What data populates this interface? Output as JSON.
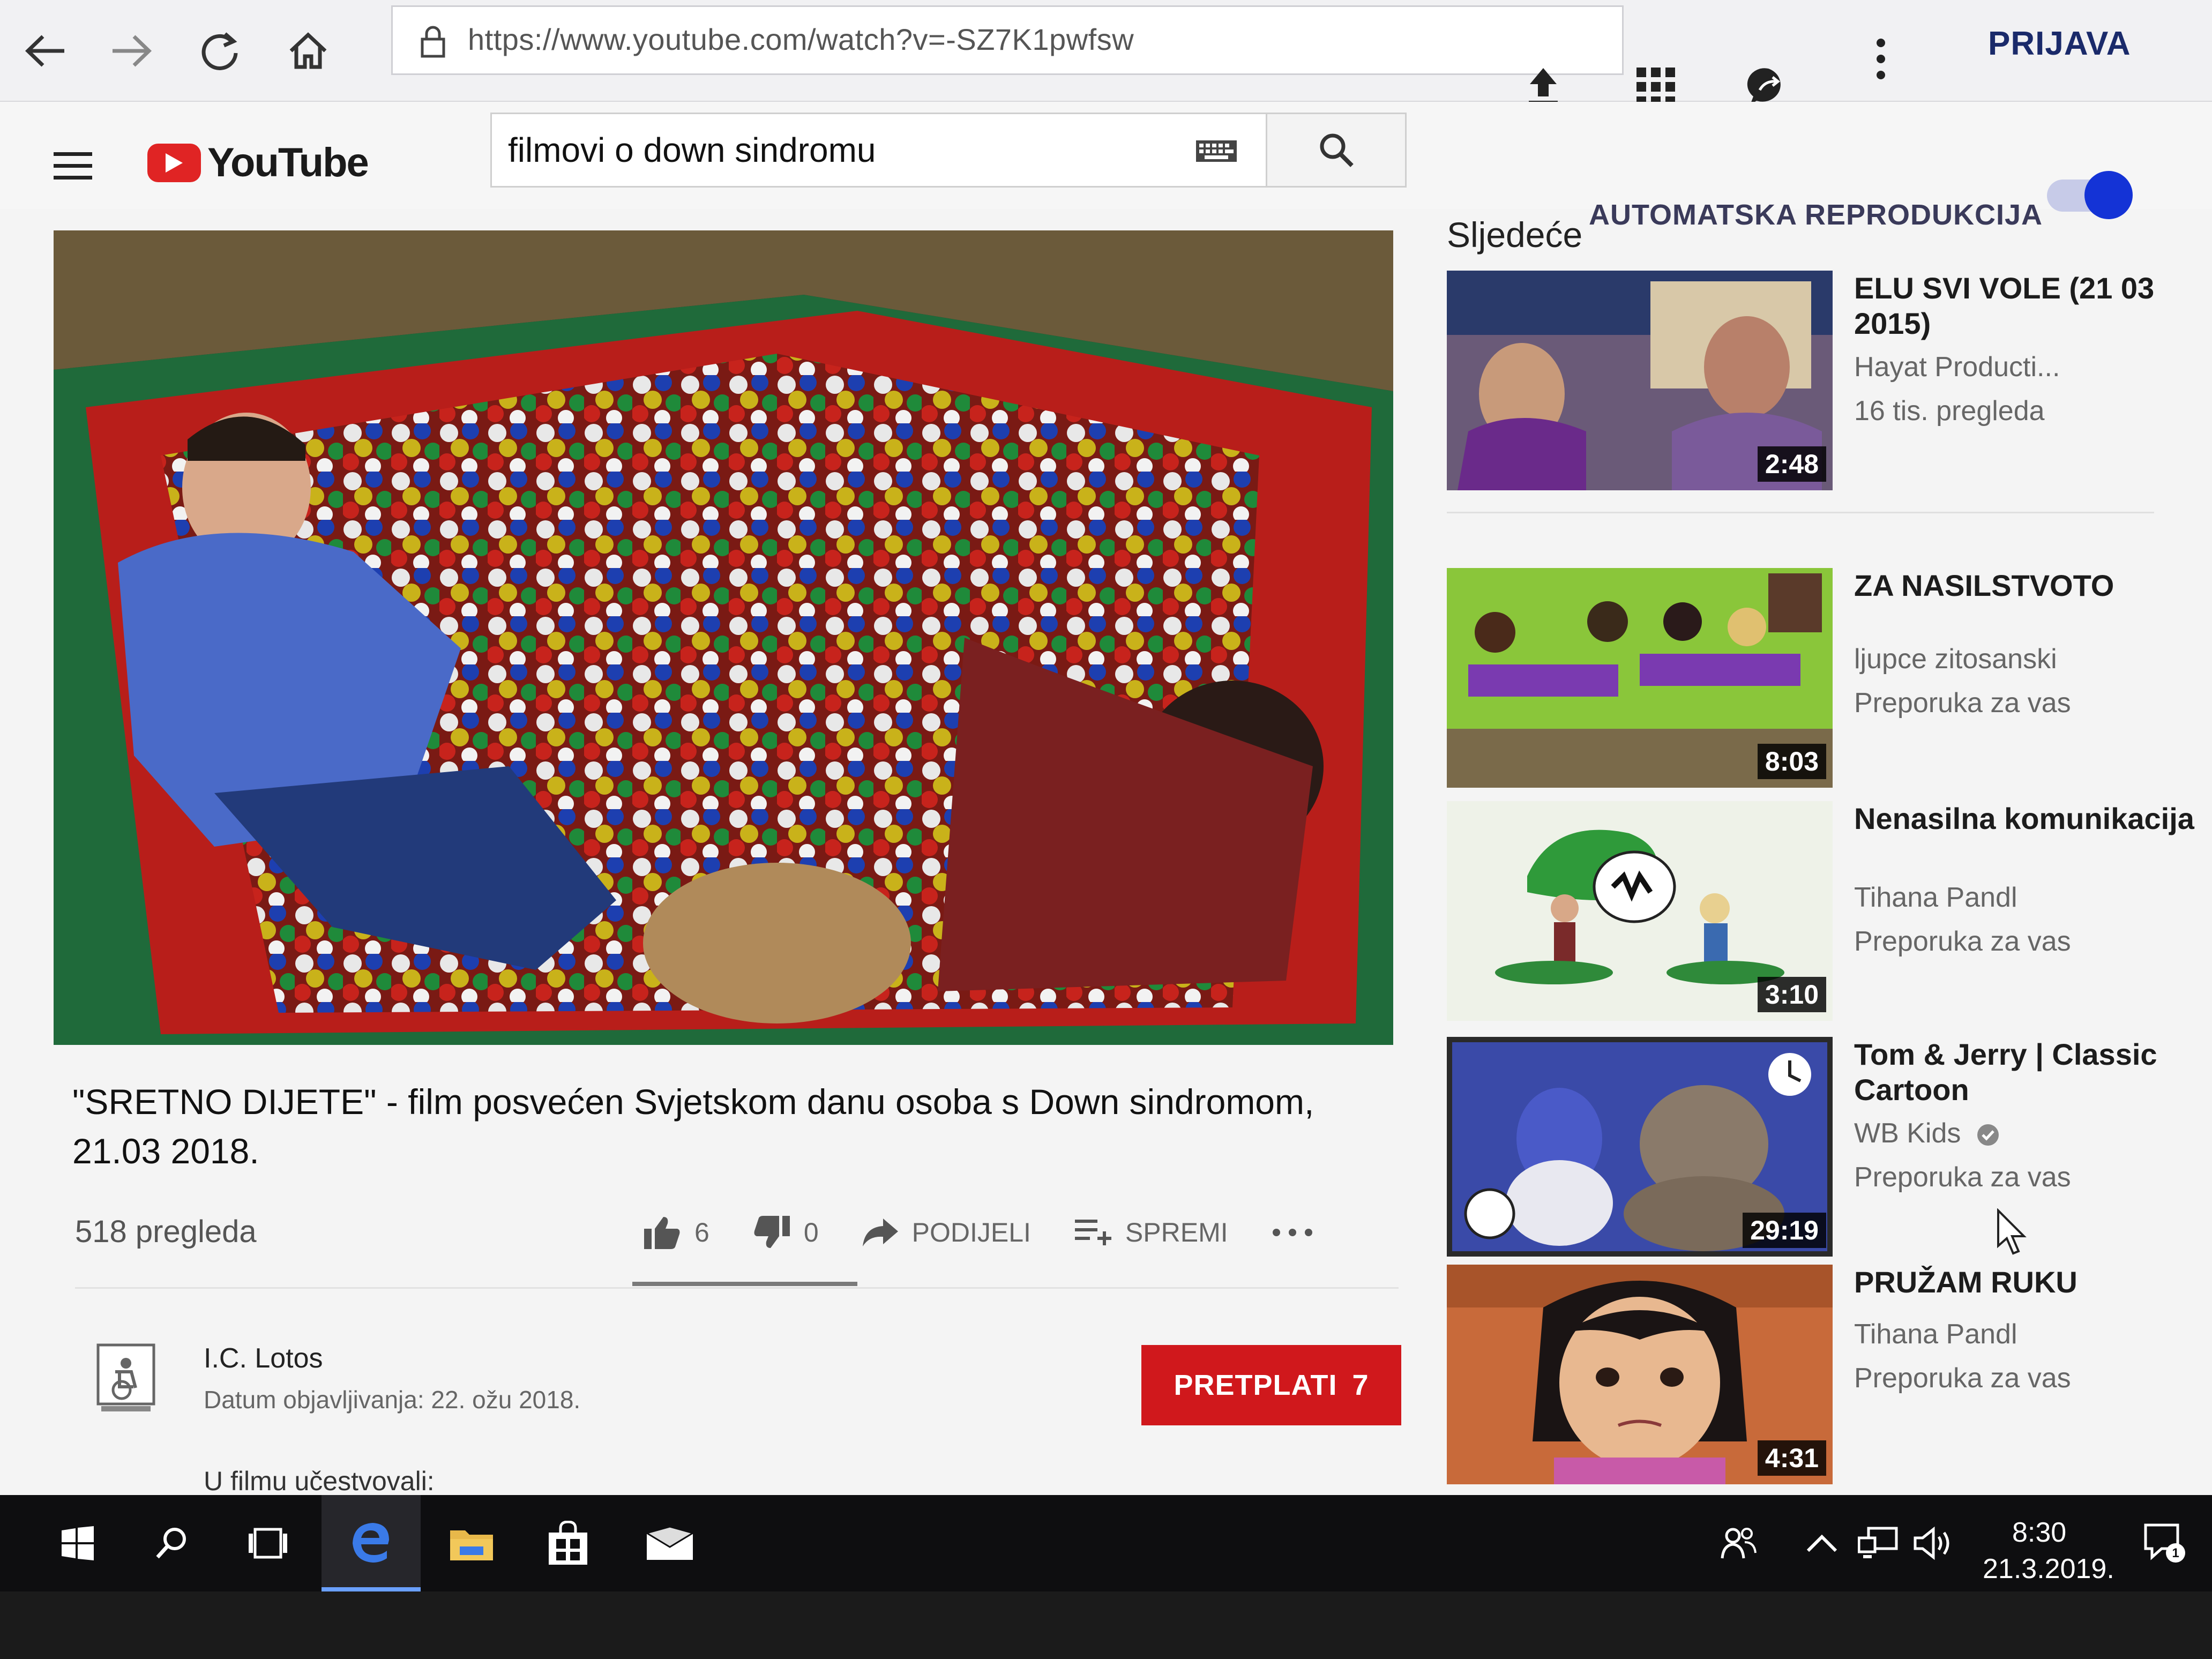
{
  "browser": {
    "url": "https://www.youtube.com/watch?v=-SZ7K1pwfsw",
    "signin_label": "PRIJAVA"
  },
  "youtube": {
    "logo_text": "YouTube",
    "search_value": "filmovi o down sindromu"
  },
  "video": {
    "title": "\"SRETNO DIJETE\" - film posvećen Svjetskom danu osoba s Down sindromom, 21.03 2018.",
    "views": "518 pregleda",
    "likes": "6",
    "dislikes": "0",
    "share_label": "PODIJELI",
    "save_label": "SPREMI",
    "channel": "I.C. Lotos",
    "published": "Datum objavljivanja: 22. ožu 2018.",
    "subscribe_label": "PRETPLATI",
    "subscriber_count": "7",
    "description_start": "U filmu učestvovali:"
  },
  "sidebar": {
    "up_next_label": "Sljedeće",
    "autoplay_label": "AUTOMATSKA REPRODUKCIJA",
    "autoplay_on": true,
    "items": [
      {
        "title": "ELU SVI VOLE (21 03 2015)",
        "channel": "Hayat Producti...",
        "meta": "16 tis. pregleda",
        "duration": "2:48"
      },
      {
        "title": "ZA NASILSTVOTO",
        "channel": "ljupce zitosanski",
        "meta": "Preporuka za vas",
        "duration": "8:03"
      },
      {
        "title": "Nenasilna komunikacija",
        "channel": "Tihana Pandl",
        "meta": "Preporuka za vas",
        "duration": "3:10"
      },
      {
        "title": "Tom & Jerry | Classic Cartoon",
        "channel": "WB Kids",
        "meta": "Preporuka za vas",
        "duration": "29:19"
      },
      {
        "title": "PRUŽAM RUKU",
        "channel": "Tihana Pandl",
        "meta": "Preporuka za vas",
        "duration": "4:31"
      }
    ]
  },
  "taskbar": {
    "time": "8:30",
    "date": "21.3.2019."
  },
  "colors": {
    "youtube_red": "#e02424",
    "subscribe_red": "#d0181c",
    "toggle_blue": "#1433d6",
    "taskbar_bg": "#0e0e10"
  }
}
